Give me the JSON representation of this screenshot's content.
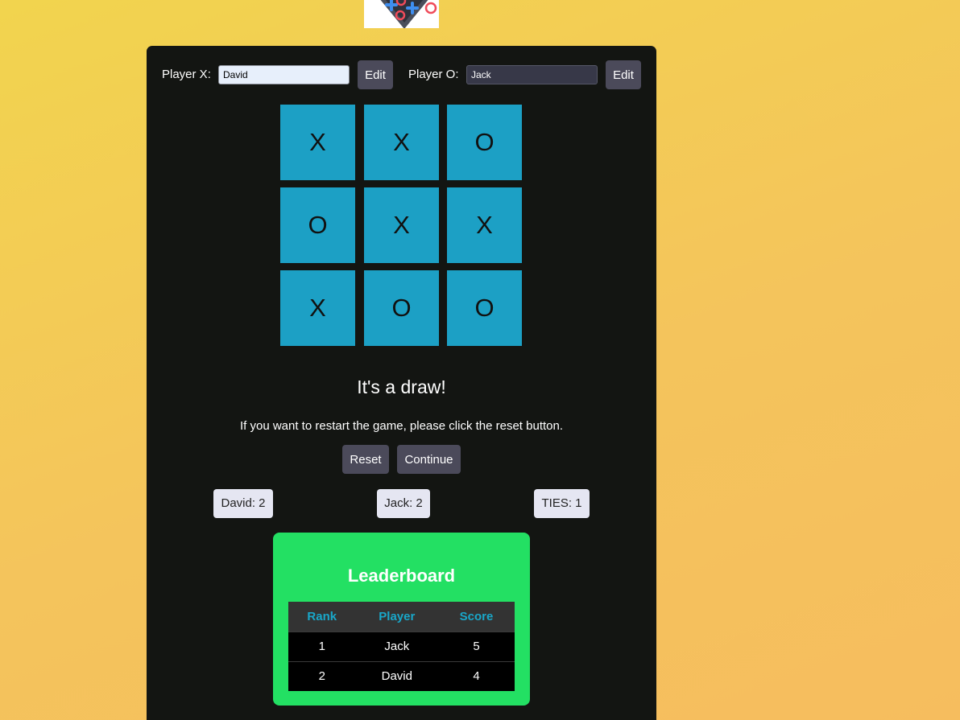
{
  "logo": {
    "icon": "tic-tac-toe-logo"
  },
  "players": {
    "x_label": "Player X:",
    "x_value": "David",
    "o_label": "Player O:",
    "o_value": "Jack",
    "edit_label": "Edit"
  },
  "board": {
    "cells": [
      "X",
      "X",
      "O",
      "O",
      "X",
      "X",
      "X",
      "O",
      "O"
    ]
  },
  "status": {
    "message": "It's a draw!",
    "hint": "If you want to restart the game, please click the reset button."
  },
  "controls": {
    "reset_label": "Reset",
    "continue_label": "Continue"
  },
  "scores": {
    "x": "David: 2",
    "o": "Jack: 2",
    "ties": "TIES: 1"
  },
  "leaderboard": {
    "title": "Leaderboard",
    "headers": [
      "Rank",
      "Player",
      "Score"
    ],
    "rows": [
      [
        "1",
        "Jack",
        "5"
      ],
      [
        "2",
        "David",
        "4"
      ]
    ]
  },
  "colors": {
    "background": "#f3c958",
    "panel": "#131512",
    "cell": "#1ca0c5",
    "button": "#4b4a5a",
    "leaderboard": "#23e063",
    "header_text": "#19a7c9"
  }
}
